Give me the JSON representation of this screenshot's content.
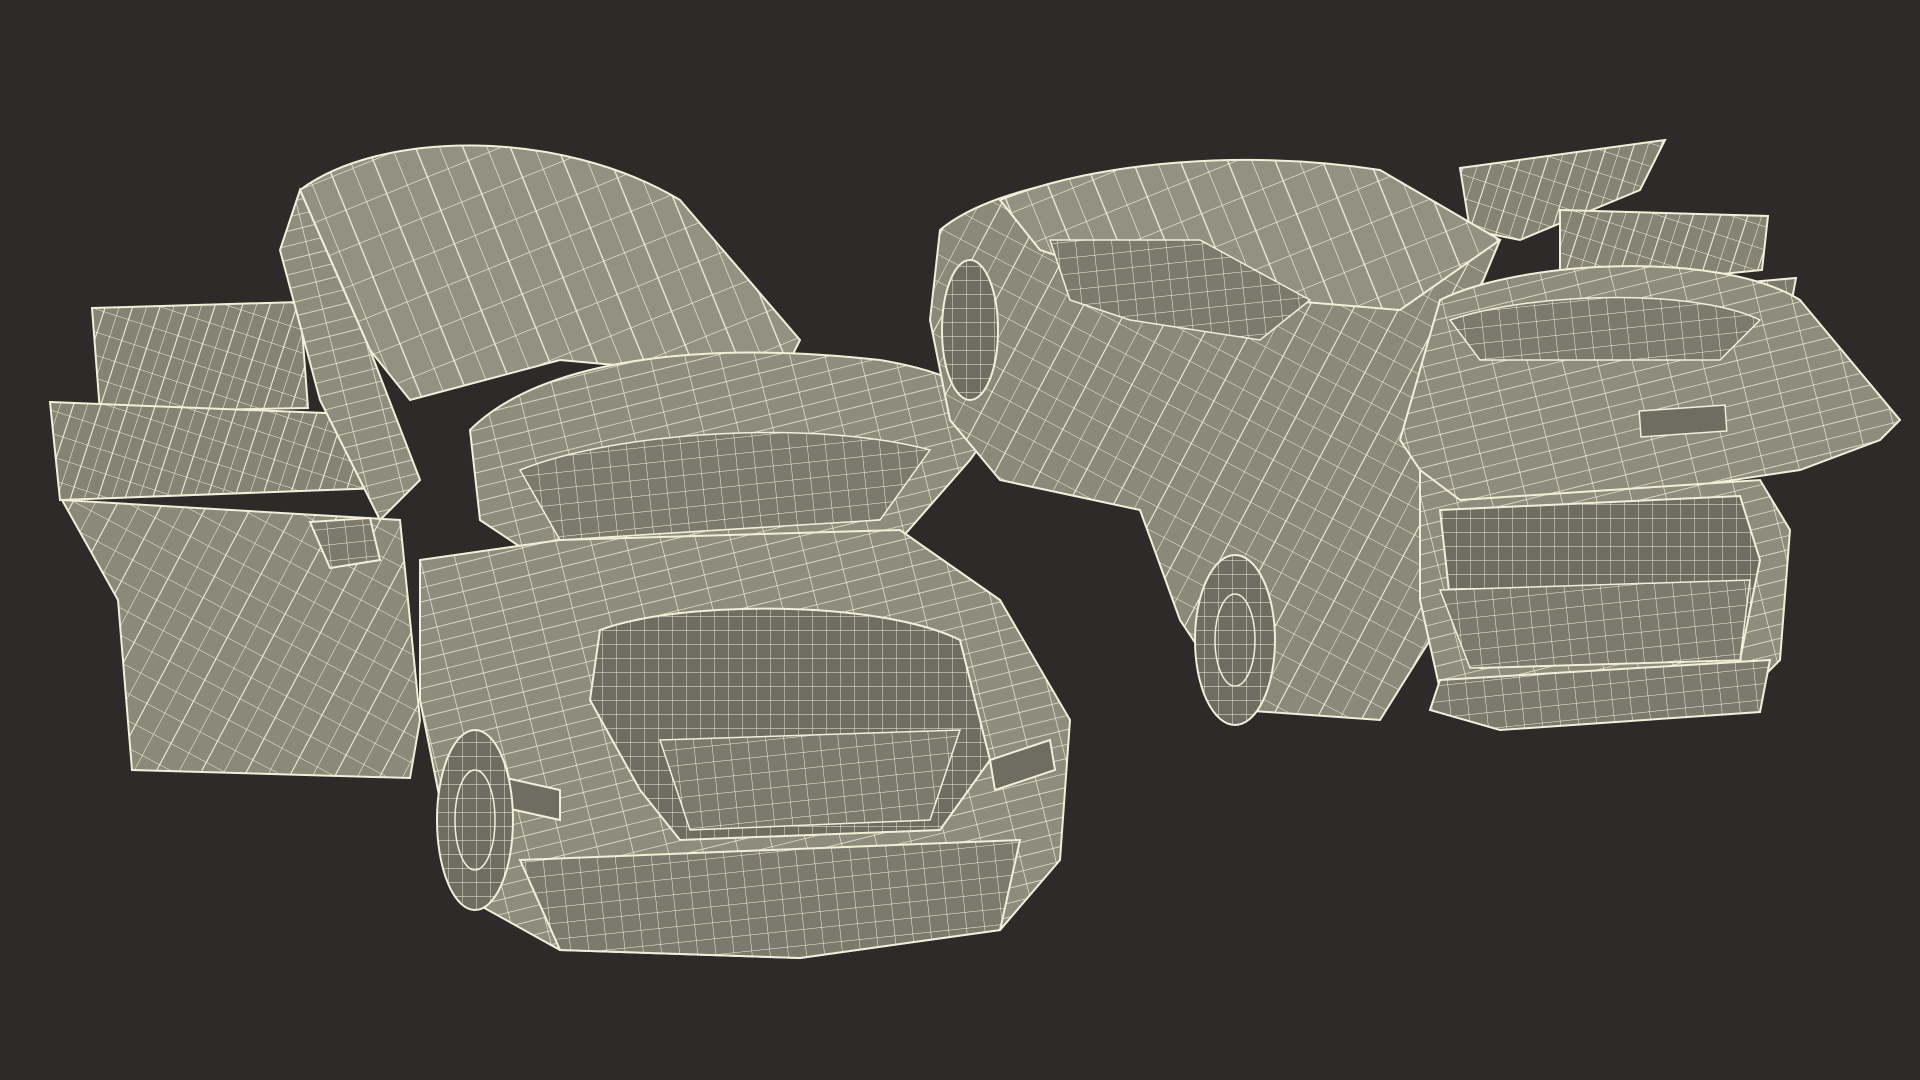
{
  "scene": {
    "background_color": "#2d2b29",
    "surface_color": "#8e8c7c",
    "surface_shade_color": "#77766a",
    "wire_color": "#f2efd9",
    "models": [
      {
        "name": "front-view-car",
        "hood_open": true,
        "doors_open": true
      },
      {
        "name": "rear-view-car",
        "tailgate_open": true,
        "doors_open": true
      }
    ]
  }
}
